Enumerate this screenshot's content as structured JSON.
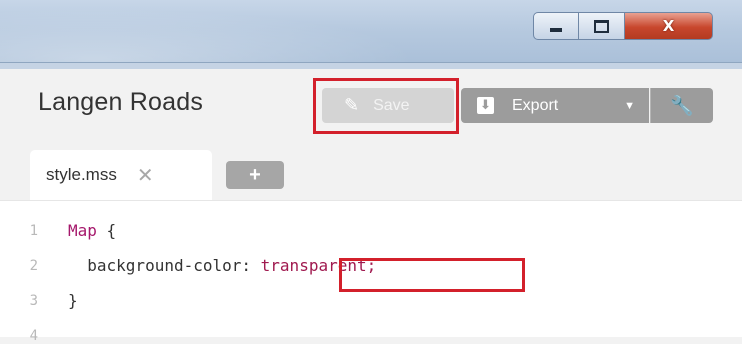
{
  "window": {
    "controls": {
      "minimize_icon": "minimize-icon",
      "maximize_icon": "maximize-icon",
      "close_label": "X"
    }
  },
  "header": {
    "title": "Langen Roads"
  },
  "toolbar": {
    "save_label": "Save",
    "save_icon": "pencil-icon",
    "export_label": "Export",
    "export_icon": "download-icon",
    "export_dropdown_icon": "caret-down-icon",
    "settings_icon": "wrench-icon"
  },
  "tabs": {
    "items": [
      {
        "label": "style.mss",
        "close_label": "✕"
      }
    ],
    "add_label": "+"
  },
  "editor": {
    "lines": [
      {
        "number": "1",
        "selector": "Map",
        "rest": " {"
      },
      {
        "number": "2",
        "property": "  background-color: ",
        "value": "transparent;"
      },
      {
        "number": "3",
        "text": "}"
      },
      {
        "number": "4",
        "text": ""
      }
    ]
  },
  "annotations": {
    "highlight_color": "#d3202b"
  }
}
